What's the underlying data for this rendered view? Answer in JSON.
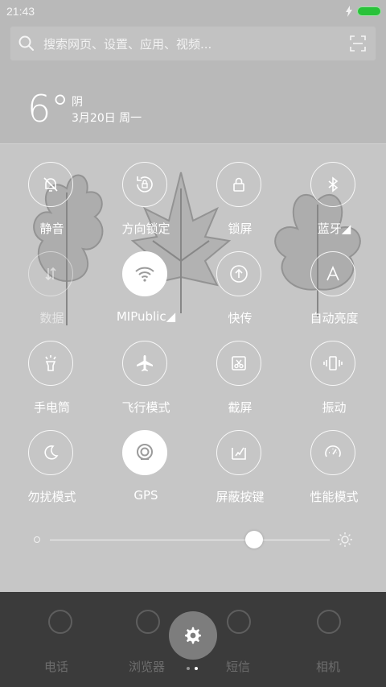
{
  "status_bar": {
    "time": "21:43",
    "battery_color": "#29c23a",
    "icons": [
      "charging-bolt-icon",
      "battery-icon"
    ]
  },
  "search": {
    "placeholder": "搜索网页、设置、应用、视频..."
  },
  "weather": {
    "temperature": "6°",
    "condition": "阴",
    "date": "3月20日 周一"
  },
  "toggles": [
    {
      "label": "静音",
      "icon": "bell-off-icon",
      "state": "off"
    },
    {
      "label": "方向锁定",
      "icon": "rotation-lock-icon",
      "state": "off"
    },
    {
      "label": "锁屏",
      "icon": "lock-icon",
      "state": "off"
    },
    {
      "label": "蓝牙◢",
      "icon": "bluetooth-icon",
      "state": "off"
    },
    {
      "label": "数据",
      "icon": "mobile-data-icon",
      "state": "disabled"
    },
    {
      "label": "MIPublic◢",
      "icon": "wifi-icon",
      "state": "on"
    },
    {
      "label": "快传",
      "icon": "quick-transfer-icon",
      "state": "off"
    },
    {
      "label": "自动亮度",
      "icon": "auto-brightness-icon",
      "state": "off"
    },
    {
      "label": "手电筒",
      "icon": "flashlight-icon",
      "state": "off"
    },
    {
      "label": "飞行模式",
      "icon": "airplane-icon",
      "state": "off"
    },
    {
      "label": "截屏",
      "icon": "screenshot-icon",
      "state": "off"
    },
    {
      "label": "振动",
      "icon": "vibrate-icon",
      "state": "off"
    },
    {
      "label": "勿扰模式",
      "icon": "moon-icon",
      "state": "off"
    },
    {
      "label": "GPS",
      "icon": "gps-icon",
      "state": "on"
    },
    {
      "label": "屏蔽按键",
      "icon": "block-keys-icon",
      "state": "off"
    },
    {
      "label": "性能模式",
      "icon": "speedometer-icon",
      "state": "off"
    }
  ],
  "brightness": {
    "level": 0.73
  },
  "dock": {
    "items": [
      "电话",
      "浏览器",
      "短信",
      "相机"
    ],
    "settings_icon": "gear-icon",
    "page_index": 2,
    "page_count": 2
  }
}
